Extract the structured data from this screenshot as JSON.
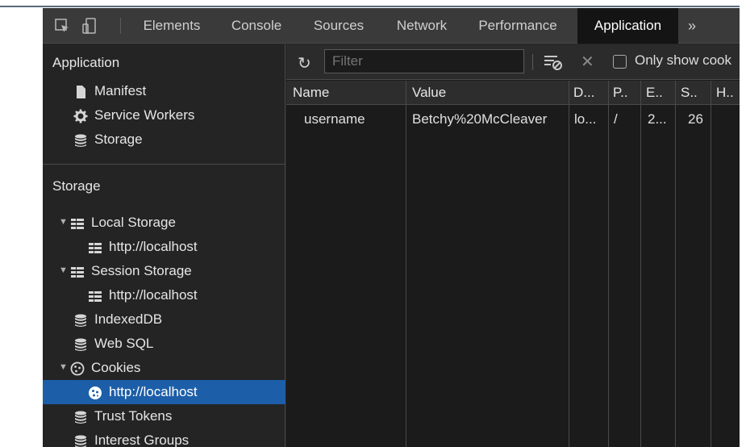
{
  "tabbar": {
    "tabs": [
      {
        "label": "Elements",
        "active": false
      },
      {
        "label": "Console",
        "active": false
      },
      {
        "label": "Sources",
        "active": false
      },
      {
        "label": "Network",
        "active": false
      },
      {
        "label": "Performance",
        "active": false
      },
      {
        "label": "Application",
        "active": true
      }
    ],
    "more_label": "»",
    "icons": [
      "inspect-icon",
      "device-toggle-icon"
    ]
  },
  "sidebar": {
    "application_title": "Application",
    "application_items": [
      {
        "label": "Manifest",
        "icon": "document-icon"
      },
      {
        "label": "Service Workers",
        "icon": "gear-icon"
      },
      {
        "label": "Storage",
        "icon": "database-icon"
      }
    ],
    "storage_title": "Storage",
    "storage_items": [
      {
        "label": "Local Storage",
        "icon": "grid-icon",
        "expanded": true
      },
      {
        "label": "http://localhost",
        "icon": "grid-icon"
      },
      {
        "label": "Session Storage",
        "icon": "grid-icon",
        "expanded": true
      },
      {
        "label": "http://localhost",
        "icon": "grid-icon"
      },
      {
        "label": "IndexedDB",
        "icon": "database-icon"
      },
      {
        "label": "Web SQL",
        "icon": "database-icon"
      },
      {
        "label": "Cookies",
        "icon": "cookie-icon",
        "expanded": true
      },
      {
        "label": "http://localhost",
        "icon": "cookie-icon",
        "selected": true
      },
      {
        "label": "Trust Tokens",
        "icon": "database-icon"
      },
      {
        "label": "Interest Groups",
        "icon": "database-icon"
      }
    ]
  },
  "toolbar": {
    "filter_placeholder": "Filter",
    "only_show_label": "Only show cook",
    "icons": [
      "refresh-icon",
      "clear-filter-icon",
      "close-icon"
    ]
  },
  "table": {
    "columns": [
      "Name",
      "Value",
      "D...",
      "P..",
      "E..",
      "S..",
      "H.."
    ],
    "rows": [
      [
        "username",
        "Betchy%20McCleaver",
        "lo...",
        "/",
        "2...",
        "26",
        ""
      ]
    ]
  },
  "colors": {
    "selected": "#1d5ea8",
    "tab_active": "#141414",
    "panel_bg": "#242424"
  }
}
